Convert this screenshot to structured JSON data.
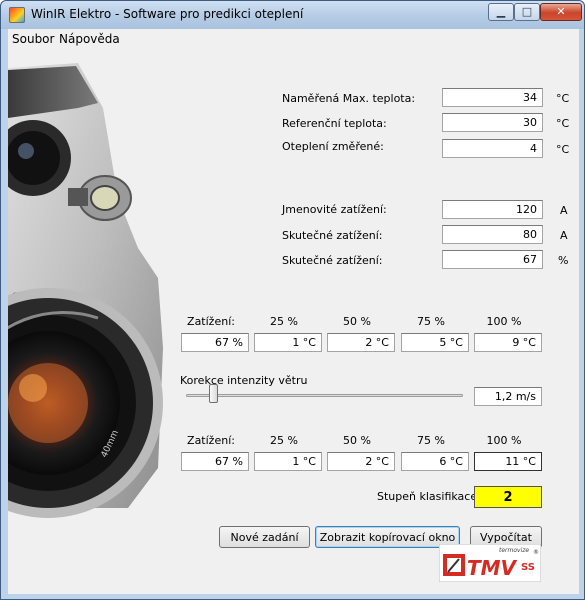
{
  "window": {
    "title": "WinIR Elektro - Software pro predikci oteplení",
    "controls": {
      "minimize": "▁",
      "maximize": "□",
      "close": "✕"
    }
  },
  "menu": {
    "items": [
      "Soubor",
      "Nápověda"
    ]
  },
  "temps": {
    "measured_max": {
      "label": "Naměřená Max. teplota:",
      "value": "34",
      "unit": "°C"
    },
    "reference": {
      "label": "Referenční teplota:",
      "value": "30",
      "unit": "°C"
    },
    "rise_measured": {
      "label": "Oteplení změřené:",
      "value": "4",
      "unit": "°C"
    }
  },
  "loads": {
    "nominal": {
      "label": "Jmenovité zatížení:",
      "value": "120",
      "unit": "A"
    },
    "actual_a": {
      "label": "Skutečné zatížení:",
      "value": "80",
      "unit": "A"
    },
    "actual_pct": {
      "label": "Skutečné zatížení:",
      "value": "67",
      "unit": "%"
    }
  },
  "table1": {
    "headers": [
      "Zatížení:",
      "25 %",
      "50 %",
      "75 %",
      "100 %"
    ],
    "values": [
      "67 %",
      "1 °C",
      "2 °C",
      "5 °C",
      "9 °C"
    ]
  },
  "wind": {
    "label": "Korekce intenzity větru",
    "value": "1,2 m/s",
    "slider_fraction": 0.1
  },
  "table2": {
    "headers": [
      "Zatížení:",
      "25 %",
      "50 %",
      "75 %",
      "100 %"
    ],
    "values": [
      "67 %",
      "1 °C",
      "2 °C",
      "6 °C",
      "11 °C"
    ]
  },
  "classification": {
    "label": "Stupeň klasifikace:",
    "value": "2",
    "color": "#ffff00"
  },
  "buttons": {
    "new_input": "Nové zadání",
    "show_copy": "Zobrazit kopírovací okno",
    "calculate": "Vypočítat"
  },
  "logo": {
    "text": "TMV",
    "suffix": "SS",
    "tagline": "termovize",
    "mark": "®"
  },
  "colors": {
    "title_bar": "#b7cde6",
    "close_button": "#c8452b",
    "logo_red": "#d62b22"
  }
}
